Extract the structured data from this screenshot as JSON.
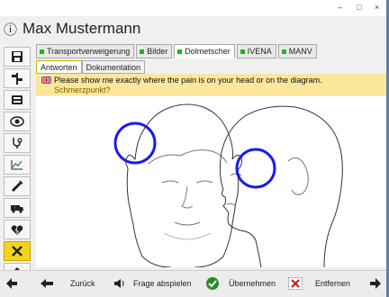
{
  "window": {
    "title": "Max Mustermann",
    "controls": [
      "–",
      "□",
      "×"
    ]
  },
  "tabs_main": [
    {
      "label": "Transportverweigerung",
      "has_dot": true
    },
    {
      "label": "Bilder",
      "has_dot": true
    },
    {
      "label": "Dolmetscher",
      "has_dot": true,
      "active": true
    },
    {
      "label": "IVENA",
      "has_dot": true
    },
    {
      "label": "MANV",
      "has_dot": true
    }
  ],
  "tabs_sub": [
    {
      "label": "Antworten",
      "active": true
    },
    {
      "label": "Dokumentation"
    }
  ],
  "question": {
    "english": "Please show me exactly where the pain is on your head or on the diagram.",
    "german": "Schmerzpunkt?",
    "flag": "uk-flag-icon"
  },
  "sidebar_icons": [
    "save-icon",
    "signpost-icon",
    "keyboard-icon",
    "eye-icon",
    "stethoscope-icon",
    "chart-icon",
    "syringe-icon",
    "ambulance-icon",
    "broken-heart-icon",
    "tools-icon",
    "arrow-up-icon",
    "arrow-left-icon"
  ],
  "bottom": {
    "back": "Zurück",
    "play": "Frage abspielen",
    "accept": "Übernehmen",
    "remove": "Entfernen"
  },
  "colors": {
    "accent": "#f5d31c",
    "banner": "#fbe79b",
    "marker": "#1a1af0"
  }
}
